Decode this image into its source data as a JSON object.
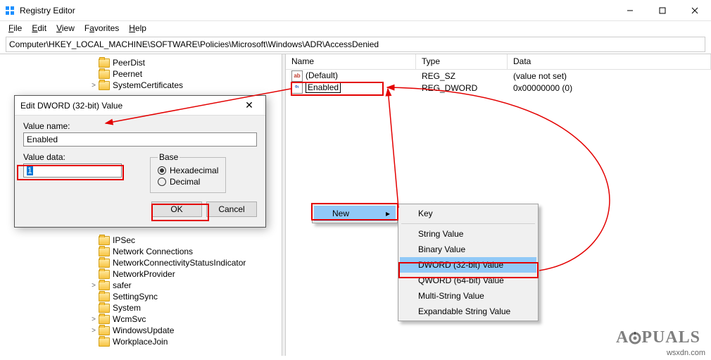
{
  "window": {
    "title": "Registry Editor"
  },
  "menubar": {
    "file": "File",
    "edit": "Edit",
    "view": "View",
    "favorites": "Favorites",
    "help": "Help"
  },
  "address": "Computer\\HKEY_LOCAL_MACHINE\\SOFTWARE\\Policies\\Microsoft\\Windows\\ADR\\AccessDenied",
  "tree": {
    "top": [
      {
        "label": "PeerDist",
        "indent": 126
      },
      {
        "label": "Peernet",
        "indent": 126
      },
      {
        "label": "SystemCertificates",
        "indent": 126,
        "expander": ">"
      }
    ],
    "bottom": [
      {
        "label": "IPSec",
        "indent": 126
      },
      {
        "label": "Network Connections",
        "indent": 126
      },
      {
        "label": "NetworkConnectivityStatusIndicator",
        "indent": 126
      },
      {
        "label": "NetworkProvider",
        "indent": 126
      },
      {
        "label": "safer",
        "indent": 126,
        "expander": ">"
      },
      {
        "label": "SettingSync",
        "indent": 126
      },
      {
        "label": "System",
        "indent": 126
      },
      {
        "label": "WcmSvc",
        "indent": 126,
        "expander": ">"
      },
      {
        "label": "WindowsUpdate",
        "indent": 126,
        "expander": ">"
      },
      {
        "label": "WorkplaceJoin",
        "indent": 126
      }
    ]
  },
  "list": {
    "headers": {
      "name": "Name",
      "type": "Type",
      "data": "Data"
    },
    "rows": [
      {
        "icon": "sz",
        "icon_text": "ab",
        "name": "(Default)",
        "type": "REG_SZ",
        "data": "(value not set)"
      },
      {
        "icon": "dw",
        "icon_text": "011\n110",
        "name": "Enabled",
        "type": "REG_DWORD",
        "data": "0x00000000 (0)",
        "editing": true
      }
    ]
  },
  "context_menu_1": {
    "new": "New"
  },
  "context_menu_2": {
    "items": [
      {
        "label": "Key"
      },
      {
        "sep": true
      },
      {
        "label": "String Value"
      },
      {
        "label": "Binary Value"
      },
      {
        "label": "DWORD (32-bit) Value",
        "highlight": true
      },
      {
        "label": "QWORD (64-bit) Value"
      },
      {
        "label": "Multi-String Value"
      },
      {
        "label": "Expandable String Value"
      }
    ]
  },
  "dialog": {
    "title": "Edit DWORD (32-bit) Value",
    "value_name_label": "Value name:",
    "value_name": "Enabled",
    "value_data_label": "Value data:",
    "value_data": "1",
    "base_label": "Base",
    "hex": "Hexadecimal",
    "dec": "Decimal",
    "ok": "OK",
    "cancel": "Cancel"
  },
  "watermarks": {
    "appuals": "A   PUALS",
    "site": "wsxdn.com"
  }
}
